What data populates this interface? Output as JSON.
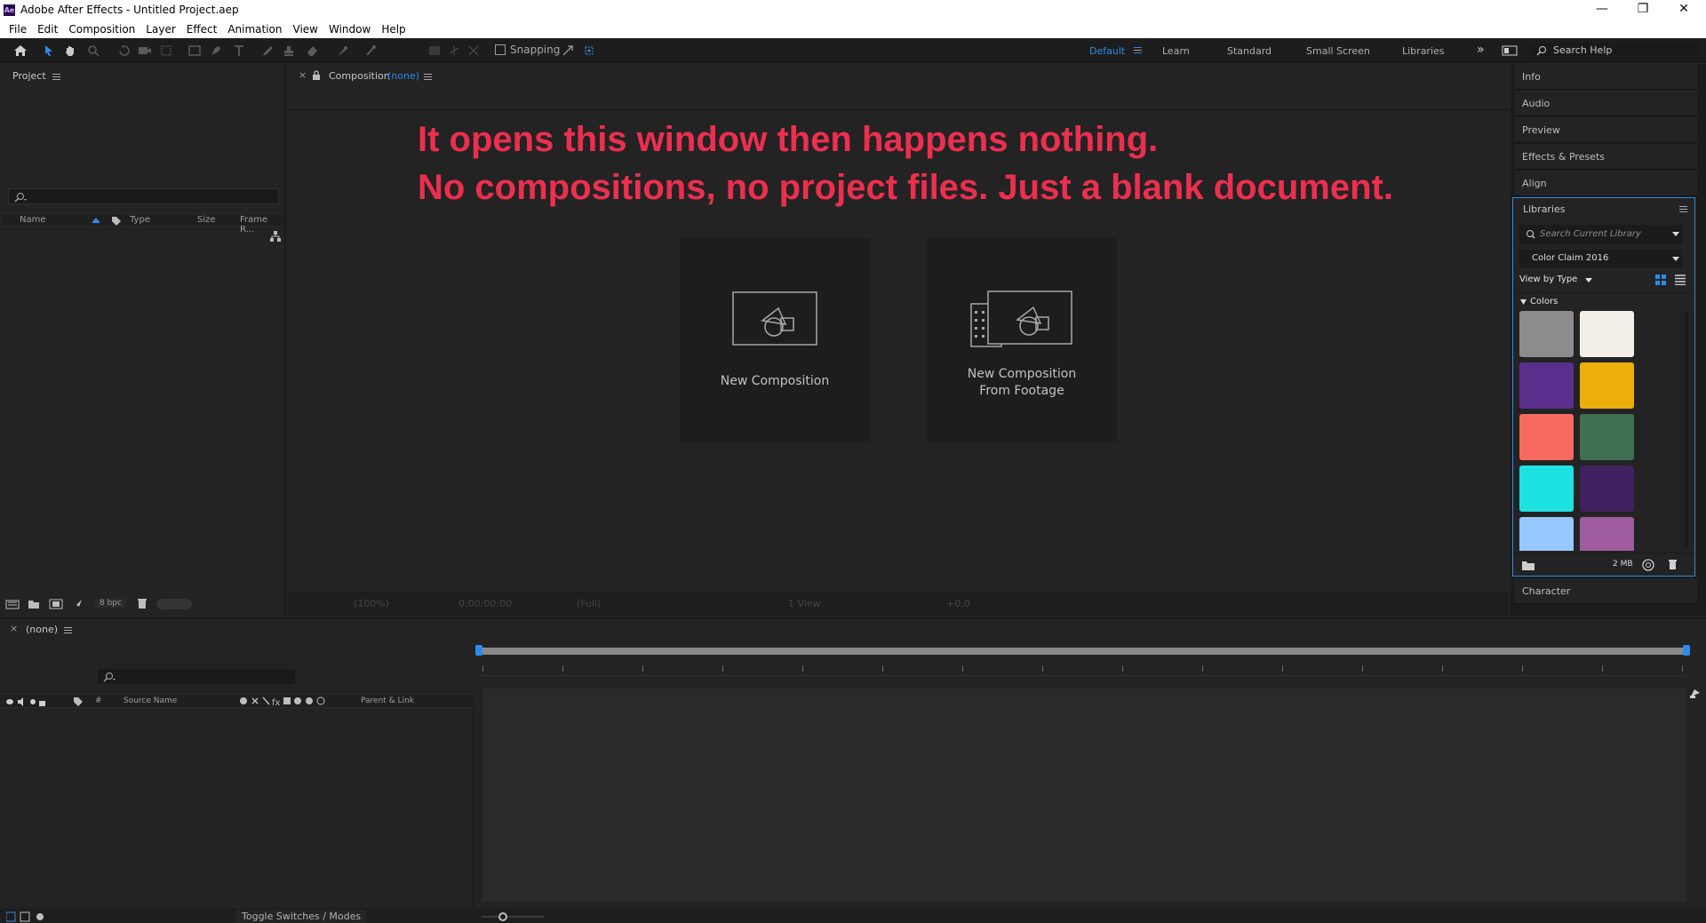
{
  "window": {
    "title": "Adobe After Effects - Untitled Project.aep",
    "app_badge": "Ae",
    "minimize": "—",
    "maximize": "❐",
    "close": "✕"
  },
  "menu": [
    "File",
    "Edit",
    "Composition",
    "Layer",
    "Effect",
    "Animation",
    "View",
    "Window",
    "Help"
  ],
  "toolbar": {
    "snapping_label": "Snapping",
    "workspaces": [
      "Default",
      "Learn",
      "Standard",
      "Small Screen",
      "Libraries"
    ],
    "active_workspace": "Default",
    "more": "»",
    "search_help": "Search Help"
  },
  "project": {
    "tab": "Project",
    "columns": [
      "Name",
      "Type",
      "Size",
      "Frame R..."
    ],
    "bpc": "8 bpc"
  },
  "composition": {
    "tab_prefix": "Composition",
    "tab_name": "(none)",
    "annotation_line1": "It opens this window then happens nothing.",
    "annotation_line2": "No compositions, no project files. Just a blank document.",
    "card_new": "New Composition",
    "card_footage_line1": "New Composition",
    "card_footage_line2": "From Footage",
    "footer": {
      "zoom": "(100%)",
      "timecode": "0:00:00:00",
      "resolution": "(Full)",
      "views": "1 View",
      "exposure": "+0.0"
    }
  },
  "right_panels": {
    "items": [
      "Info",
      "Audio",
      "Preview",
      "Effects & Presets",
      "Align"
    ],
    "libraries": {
      "title": "Libraries",
      "search_placeholder": "Search Current Library",
      "selected_library": "Color Claim 2016",
      "view_by": "View by Type",
      "section": "Colors",
      "swatches": [
        "#8c8c8c",
        "#f3eee6",
        "#5a2e8c",
        "#ecae09",
        "#f66a5f",
        "#3f7051",
        "#1ee1e1",
        "#40205f",
        "#96c8ff",
        "#9e5c9e"
      ],
      "storage": "2 MB"
    },
    "character": "Character"
  },
  "timeline": {
    "tab": "(none)",
    "columns": {
      "number": "#",
      "source_name": "Source Name",
      "parent_link": "Parent & Link"
    },
    "toggle_label": "Toggle Switches / Modes"
  }
}
